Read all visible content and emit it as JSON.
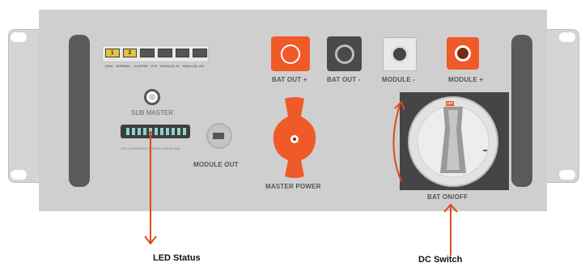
{
  "panel": {
    "ports": [
      {
        "label": "DATA",
        "lit": true,
        "num": "1"
      },
      {
        "label": "INTERNAL",
        "lit": true,
        "num": "2"
      },
      {
        "label": "CLUSTER",
        "lit": false,
        "num": ""
      },
      {
        "label": "PCS",
        "lit": false,
        "num": ""
      },
      {
        "label": "PARALLEL IN",
        "lit": false,
        "num": ""
      },
      {
        "label": "PARALLEL OUT",
        "lit": false,
        "num": ""
      }
    ],
    "sub_master": "SUB MASTER",
    "led_caption": "SOC ALARM/FAULT CHARGE STATUS RUN",
    "module_out": "MODULE OUT",
    "master_power": "MASTER POWER",
    "bat_out_pos": "BAT OUT +",
    "bat_out_neg": "BAT OUT -",
    "module_neg": "MODULE -",
    "module_pos": "MODULE +",
    "bat_onoff": "BAT ON/OFF",
    "switch_tag": "OFF"
  },
  "callouts": {
    "led_status": "LED Status",
    "dc_switch": "DC Switch"
  },
  "colors": {
    "accent": "#f05a28",
    "panel": "#cfcfcf",
    "dark": "#4a4a4a"
  }
}
